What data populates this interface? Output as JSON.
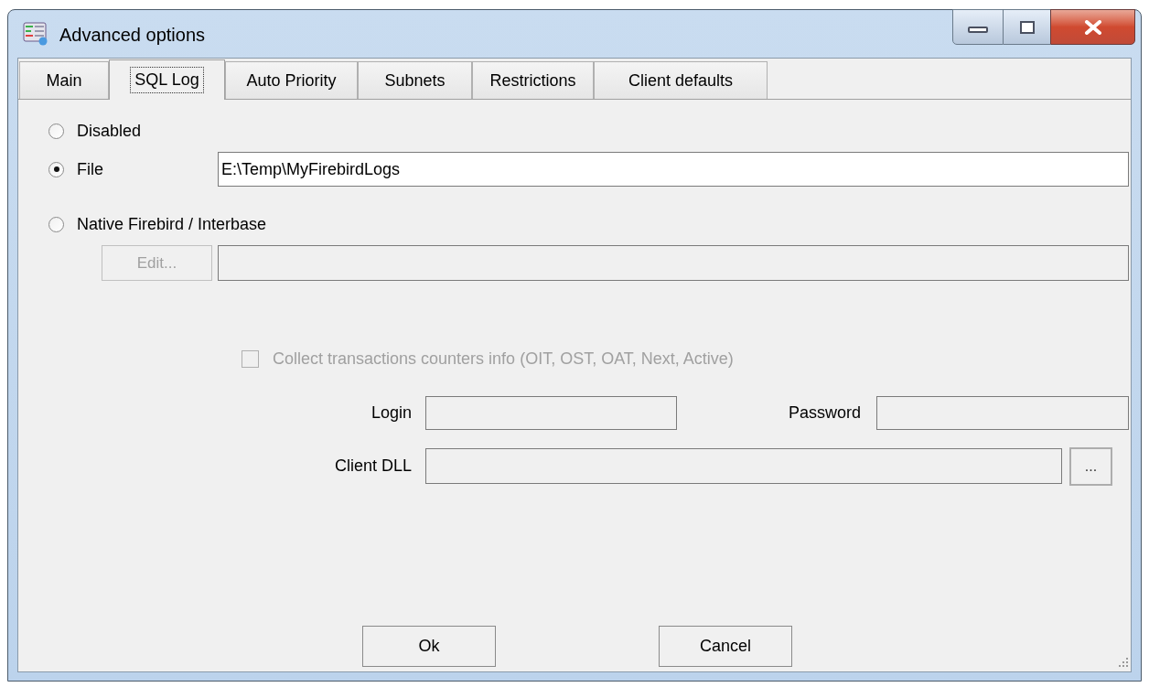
{
  "window": {
    "title": "Advanced options"
  },
  "tabs": [
    {
      "label": "Main",
      "selected": false
    },
    {
      "label": "SQL Log",
      "selected": true
    },
    {
      "label": "Auto Priority",
      "selected": false
    },
    {
      "label": "Subnets",
      "selected": false
    },
    {
      "label": "Restrictions",
      "selected": false
    },
    {
      "label": "Client defaults",
      "selected": false
    }
  ],
  "log_modes": [
    {
      "label": "Disabled",
      "selected": false
    },
    {
      "label": "File",
      "selected": true
    },
    {
      "label": "Native Firebird / Interbase",
      "selected": false
    }
  ],
  "file_path": {
    "value": "E:\\Temp\\MyFirebirdLogs"
  },
  "native": {
    "edit_button": {
      "label": "Edit...",
      "disabled": true
    },
    "trace_field": {
      "disabled": true
    }
  },
  "collect_counters": {
    "label": "Collect transactions counters info (OIT, OST, OAT, Next, Active)",
    "checked": false,
    "disabled": true
  },
  "login": {
    "label": "Login",
    "disabled": true
  },
  "password": {
    "label": "Password",
    "disabled": true
  },
  "client_dll": {
    "label": "Client DLL",
    "disabled": true,
    "browse_label": "..."
  },
  "buttons": [
    "Ok",
    "Cancel"
  ]
}
